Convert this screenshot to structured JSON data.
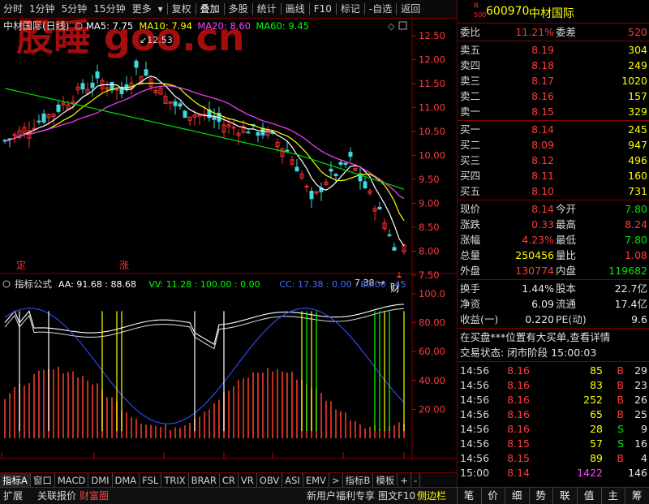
{
  "toolbar": {
    "left": [
      "分时",
      "1分钟",
      "5分钟",
      "15分钟",
      "更多"
    ],
    "right": [
      "复权",
      "叠加",
      "多股",
      "统计",
      "画线",
      "F10",
      "标记",
      "-自选",
      "返回"
    ]
  },
  "watermark": "股睡 goo.cn",
  "chart": {
    "title": "中材国际(日线)",
    "ma_labels": [
      {
        "text": "MA5: 7.75",
        "color": "#ffffff"
      },
      {
        "text": "MA10: 7.94",
        "color": "#ffff00"
      },
      {
        "text": "MA20: 8.60",
        "color": "#ff40ff"
      },
      {
        "text": "MA60: 9.45",
        "color": "#00ff00"
      }
    ],
    "price_axis": [
      "12.50",
      "12.00",
      "11.50",
      "11.00",
      "10.50",
      "10.00",
      "9.50",
      "9.00",
      "8.50",
      "8.00",
      "7.50"
    ],
    "high_marker": "12.53",
    "low_marker": "7.38",
    "markers": {
      "ding": "定",
      "zhang": "涨",
      "cai": "财"
    },
    "indicator_title": "指标公式",
    "indicator_labels": [
      {
        "text": "AA: 91.68 : 88.68",
        "color": "#ffffff"
      },
      {
        "text": "VV: 11.28 : 100.00 : 0.00",
        "color": "#00ff00"
      },
      {
        "text": "CC: 17.38 : 0.00 : 80.00 : 45",
        "color": "#4a6cff"
      }
    ],
    "indicator_axis": [
      "100.0",
      "80.00",
      "60.00",
      "40.00",
      "20.00"
    ],
    "date_axis": [
      "2021年",
      "12",
      "1",
      "2",
      "3",
      "4",
      "5"
    ],
    "period_label": "日线"
  },
  "tabs": [
    "指标A",
    "窗口",
    "MACD",
    "DMI",
    "DMA",
    "FSL",
    "TRIX",
    "BRAR",
    "CR",
    "VR",
    "OBV",
    "ASI",
    "EMV",
    ">",
    "指标B",
    "模板",
    "+",
    "-"
  ],
  "status": {
    "left": [
      "扩展",
      "关联报价",
      "财富圈"
    ],
    "middle": [
      "新用户福利专享",
      "图文F10",
      "侧边栏"
    ],
    "nav": [
      "笔",
      "价",
      "细",
      "势",
      "联",
      "值",
      "主",
      "筹"
    ]
  },
  "quote": {
    "code": "600970",
    "name": "中材国际",
    "badge_r": "R",
    "badge_num": "500",
    "weibi_label": "委比",
    "weibi": "11.21%",
    "weicha_label": "委差",
    "weicha": "520",
    "asks": [
      {
        "label": "卖五",
        "price": "8.19",
        "vol": "304"
      },
      {
        "label": "卖四",
        "price": "8.18",
        "vol": "249"
      },
      {
        "label": "卖三",
        "price": "8.17",
        "vol": "1020"
      },
      {
        "label": "卖二",
        "price": "8.16",
        "vol": "157"
      },
      {
        "label": "卖一",
        "price": "8.15",
        "vol": "329"
      }
    ],
    "bids": [
      {
        "label": "买一",
        "price": "8.14",
        "vol": "245"
      },
      {
        "label": "买二",
        "price": "8.09",
        "vol": "947"
      },
      {
        "label": "买三",
        "price": "8.12",
        "vol": "496"
      },
      {
        "label": "买四",
        "price": "8.11",
        "vol": "160"
      },
      {
        "label": "买五",
        "price": "8.10",
        "vol": "731"
      }
    ],
    "stats": [
      {
        "l1": "现价",
        "v1": "8.14",
        "c1": "red",
        "l2": "今开",
        "v2": "7.80",
        "c2": "green"
      },
      {
        "l1": "涨跌",
        "v1": "0.33",
        "c1": "red",
        "l2": "最高",
        "v2": "8.24",
        "c2": "red"
      },
      {
        "l1": "涨幅",
        "v1": "4.23%",
        "c1": "red",
        "l2": "最低",
        "v2": "7.80",
        "c2": "green"
      },
      {
        "l1": "总量",
        "v1": "250456",
        "c1": "yel",
        "l2": "量比",
        "v2": "1.08",
        "c2": "red"
      },
      {
        "l1": "外盘",
        "v1": "130774",
        "c1": "red",
        "l2": "内盘",
        "v2": "119682",
        "c2": "green"
      }
    ],
    "stats2": [
      {
        "l1": "换手",
        "v1": "1.44%",
        "l2": "股本",
        "v2": "22.7亿"
      },
      {
        "l1": "净资",
        "v1": "6.09",
        "l2": "流通",
        "v2": "17.4亿"
      },
      {
        "l1": "收益(一)",
        "v1": "0.220",
        "l2": "PE(动)",
        "v2": "9.6"
      }
    ],
    "notice": "在买盘***位置有大买单,查看详情",
    "trade_state": "交易状态: 闭市阶段 15:00:03",
    "ticks": [
      {
        "t": "14:56",
        "p": "8.16",
        "v": "85",
        "bs": "B",
        "n": "29"
      },
      {
        "t": "14:56",
        "p": "8.16",
        "v": "83",
        "bs": "B",
        "n": "23"
      },
      {
        "t": "14:56",
        "p": "8.16",
        "v": "252",
        "bs": "B",
        "n": "26"
      },
      {
        "t": "14:56",
        "p": "8.16",
        "v": "65",
        "bs": "B",
        "n": "25"
      },
      {
        "t": "14:56",
        "p": "8.16",
        "v": "28",
        "bs": "S",
        "n": "9"
      },
      {
        "t": "14:56",
        "p": "8.15",
        "v": "57",
        "bs": "S",
        "n": "16"
      },
      {
        "t": "14:56",
        "p": "8.15",
        "v": "89",
        "bs": "B",
        "n": "4"
      },
      {
        "t": "15:00",
        "p": "8.14",
        "v": "1422",
        "bs": "",
        "n": "146"
      }
    ]
  }
}
